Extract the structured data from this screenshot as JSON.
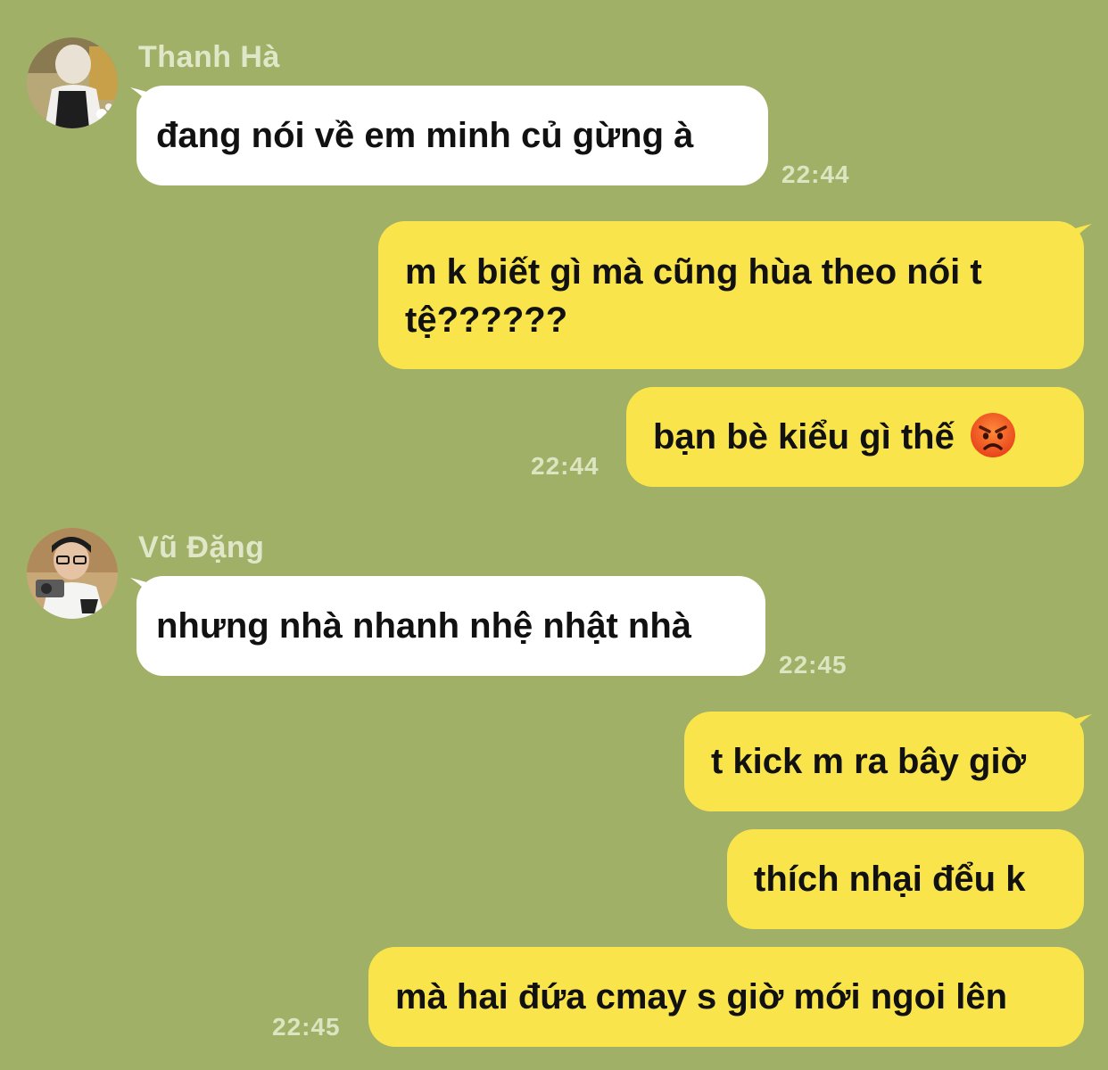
{
  "messages": [
    {
      "sender": "Thanh Hà",
      "direction": "incoming",
      "text": "đang nói về em minh củ gừng à",
      "time": "22:44"
    },
    {
      "direction": "outgoing",
      "text": "m k biết gì mà cũng hùa theo nói t tệ??????"
    },
    {
      "direction": "outgoing",
      "text": "bạn bè kiểu gì thế",
      "emoji": "angry-face-icon",
      "time": "22:44"
    },
    {
      "sender": "Vũ Đặng",
      "direction": "incoming",
      "text": "nhưng nhà nhanh nhệ nhật nhà",
      "time": "22:45"
    },
    {
      "direction": "outgoing",
      "text": "t kick m ra bây giờ"
    },
    {
      "direction": "outgoing",
      "text": "thích nhại đểu k"
    },
    {
      "direction": "outgoing",
      "text": "mà hai đứa cmay s giờ mới ngoi lên",
      "time": "22:45"
    }
  ],
  "colors": {
    "background": "#a0b066",
    "incoming_bubble": "#ffffff",
    "outgoing_bubble": "#f9e54b",
    "meta_text": "#dfe7c8"
  }
}
